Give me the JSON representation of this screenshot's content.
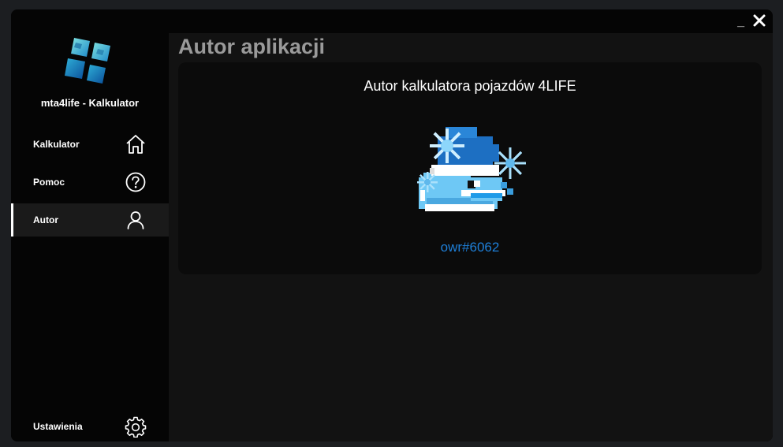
{
  "window": {
    "minimize_label": "_"
  },
  "sidebar": {
    "app_name": "mta4life - Kalkulator",
    "items": [
      {
        "label": "Kalkulator",
        "icon": "home-icon"
      },
      {
        "label": "Pomoc",
        "icon": "help-icon"
      },
      {
        "label": "Autor",
        "icon": "user-icon",
        "active": true
      }
    ],
    "settings": {
      "label": "Ustawienia",
      "icon": "gear-icon"
    }
  },
  "main": {
    "title": "Autor aplikacji",
    "card": {
      "heading": "Autor kalkulatora pojazdów 4LIFE",
      "author": "owr#6062"
    }
  },
  "colors": {
    "accent": "#1e7fd8",
    "background": "#050505",
    "panel": "#121212",
    "card": "#0b0b0b"
  }
}
